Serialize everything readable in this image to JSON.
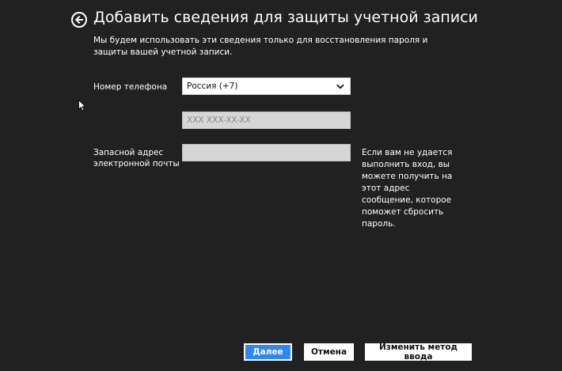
{
  "header": {
    "title": "Добавить сведения для защиты учетной записи"
  },
  "description": "Мы будем использовать эти сведения только для восстановления пароля и защиты вашей учетной записи.",
  "form": {
    "phone_label": "Номер телефона",
    "country_selected": "Россия (+7)",
    "phone_value": "",
    "phone_placeholder": "XXX XXX-XX-XX",
    "email_label": "Запасной адрес электронной почты",
    "email_value": "",
    "email_hint": "Если вам не удается выполнить вход, вы можете получить на этот адрес сообщение, которое поможет сбросить пароль."
  },
  "buttons": {
    "next": "Далее",
    "cancel": "Отмена",
    "change_input_method": "Изменить метод ввода"
  },
  "icons": {
    "back": "back-arrow-icon",
    "dropdown": "chevron-down-icon",
    "cursor": "mouse-pointer-icon"
  },
  "colors": {
    "background": "#212121",
    "accent": "#2d89ef",
    "input_fill": "#d6d6d6"
  }
}
